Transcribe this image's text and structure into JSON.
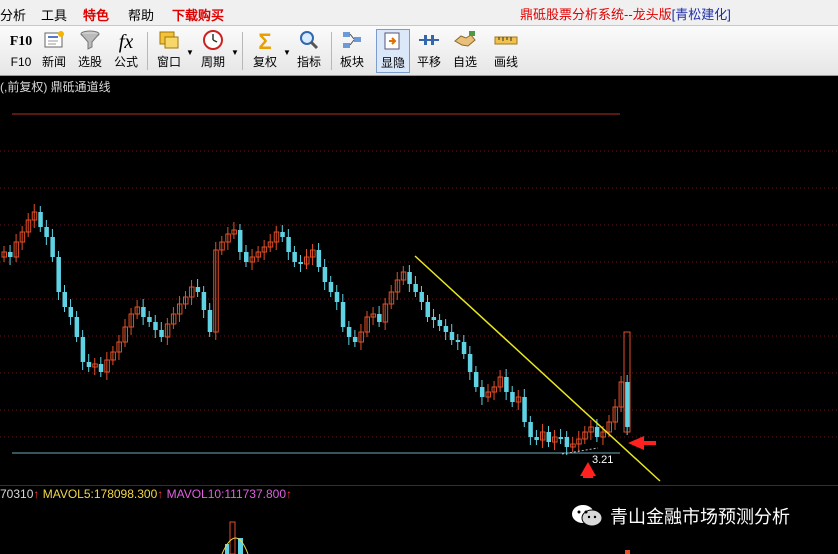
{
  "menu": {
    "items": [
      "分析",
      "工具",
      "特色",
      "帮助",
      "下载购买"
    ],
    "app_title": "鼎砥股票分析系统--龙头版",
    "app_subtitle": "[青松建化]"
  },
  "toolbar": {
    "buttons": [
      {
        "id": "f10",
        "label": "F10",
        "icon": "F10"
      },
      {
        "id": "news",
        "label": "新闻",
        "icon": "news-icon"
      },
      {
        "id": "screen",
        "label": "选股",
        "icon": "funnel-icon"
      },
      {
        "id": "formula",
        "label": "公式",
        "icon": "fx"
      },
      {
        "id": "window",
        "label": "窗口",
        "icon": "window-icon"
      },
      {
        "id": "period",
        "label": "周期",
        "icon": "clock-icon"
      },
      {
        "id": "adjust",
        "label": "复权",
        "icon": "sigma-icon"
      },
      {
        "id": "indicator",
        "label": "指标",
        "icon": "magnifier-icon"
      },
      {
        "id": "sector",
        "label": "板块",
        "icon": "blocks-icon"
      },
      {
        "id": "toggle",
        "label": "显隐",
        "icon": "toggle-icon"
      },
      {
        "id": "pan",
        "label": "平移",
        "icon": "pan-icon"
      },
      {
        "id": "watch",
        "label": "自选",
        "icon": "handshake-icon"
      },
      {
        "id": "draw",
        "label": "画线",
        "icon": "ruler-icon"
      }
    ]
  },
  "chart": {
    "label": "(,前复权) 鼎砥通道线",
    "price_annotation": "3.21"
  },
  "volume": {
    "value_fragment": "70310",
    "mavol5": "MAVOL5:178098.300",
    "mavol10": "MAVOL10:111737.800"
  },
  "watermark": {
    "text": "青山金融市场预测分析"
  },
  "colors": {
    "up": "#e0502a",
    "down": "#5fd3e4",
    "trendline": "#e8e81e",
    "arrow": "#ff2020",
    "grid": "#7a1a1a",
    "support": "#6fa8b8"
  },
  "chart_data": {
    "type": "candlestick",
    "trendline": "descending yellow line from the upper-middle of the chart to the lower right",
    "support_line": "horizontal line at the recent low",
    "annotation": "3.21",
    "markers": [
      "red arrow pointing up at the low candle",
      "red arrow pointing left at the last rising candle"
    ]
  }
}
